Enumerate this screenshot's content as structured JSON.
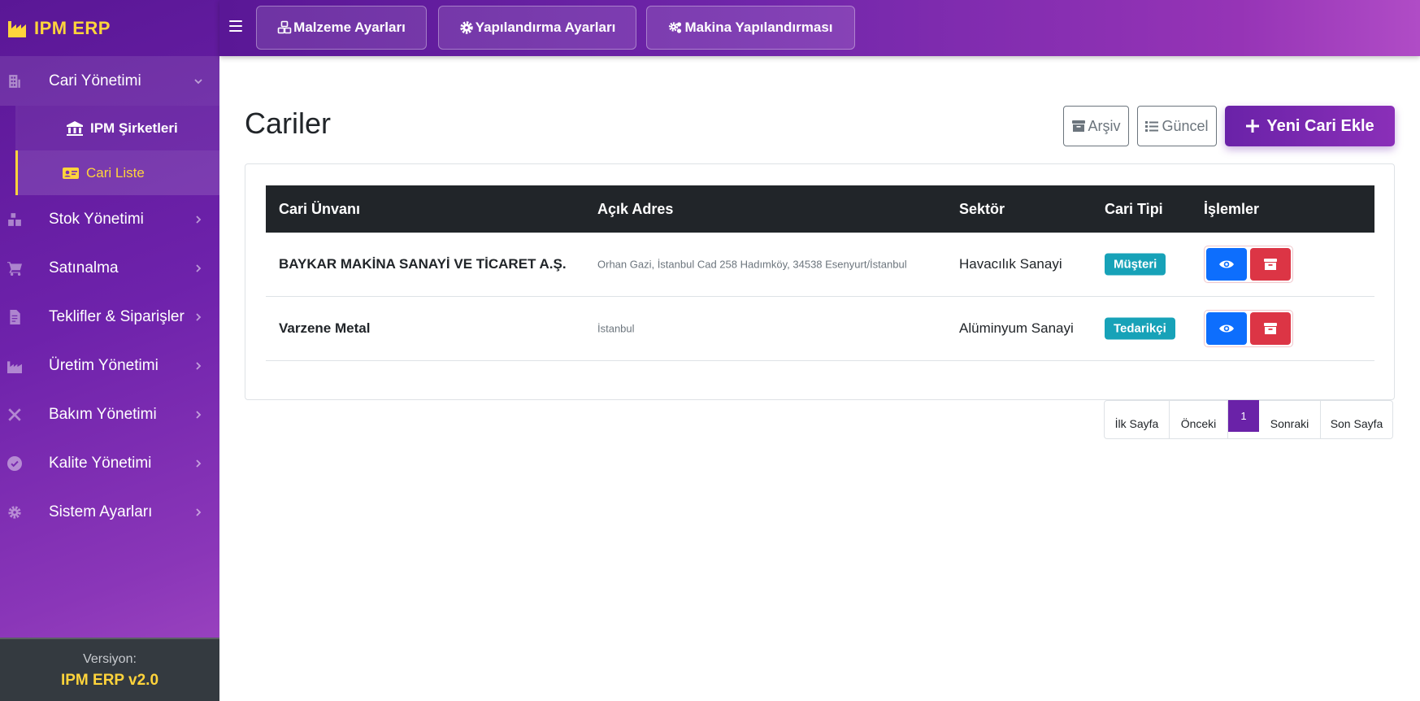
{
  "app": {
    "brand": "IPM ERP"
  },
  "topbar": {
    "buttons": [
      {
        "label": "Malzeme Ayarları",
        "icon": "cubes-icon"
      },
      {
        "label": "Yapılandırma Ayarları",
        "icon": "gear-icon"
      },
      {
        "label": "Makina Yapılandırması",
        "icon": "gears-icon"
      }
    ]
  },
  "sidebar": {
    "items": [
      {
        "label": "Cari Yönetimi",
        "icon": "building-icon",
        "expanded": true
      },
      {
        "label": "Stok Yönetimi",
        "icon": "boxes-icon"
      },
      {
        "label": "Satınalma",
        "icon": "cart-icon"
      },
      {
        "label": "Teklifler & Siparişler",
        "icon": "file-invoice-icon"
      },
      {
        "label": "Üretim Yönetimi",
        "icon": "industry-icon"
      },
      {
        "label": "Bakım Yönetimi",
        "icon": "tools-icon"
      },
      {
        "label": "Kalite Yönetimi",
        "icon": "check-circle-icon"
      },
      {
        "label": "Sistem Ayarları",
        "icon": "cog-icon"
      }
    ],
    "subitems": [
      {
        "label": "IPM Şirketleri",
        "icon": "bank-icon"
      },
      {
        "label": "Cari Liste",
        "icon": "id-card-icon",
        "active": true
      }
    ],
    "footer": {
      "label": "Versiyon:",
      "value": "IPM ERP v2.0"
    }
  },
  "main": {
    "title": "Cariler",
    "buttons": {
      "archive": "Arşiv",
      "current": "Güncel",
      "new": "Yeni Cari Ekle"
    },
    "table": {
      "headers": [
        "Cari Ünvanı",
        "Açık Adres",
        "Sektör",
        "Cari Tipi",
        "İşlemler"
      ],
      "rows": [
        {
          "name": "BAYKAR MAKİNA SANAYİ VE TİCARET A.Ş.",
          "address": "Orhan Gazi, İstanbul Cad 258 Hadımköy, 34538 Esenyurt/İstanbul",
          "sector": "Havacılık Sanayi",
          "type": "Müşteri"
        },
        {
          "name": "Varzene Metal",
          "address": "İstanbul",
          "sector": "Alüminyum Sanayi",
          "type": "Tedarikçi"
        }
      ]
    },
    "pagination": {
      "first": "İlk Sayfa",
      "prev": "Önceki",
      "current": "1",
      "next": "Sonraki",
      "last": "Son Sayfa"
    }
  },
  "colors": {
    "primary_purple": "#6a22a8",
    "accent_yellow": "#ffd43b",
    "badge_teal": "#17a2b8",
    "view_blue": "#0d6efd",
    "delete_red": "#dc3545",
    "table_header": "#212529"
  }
}
